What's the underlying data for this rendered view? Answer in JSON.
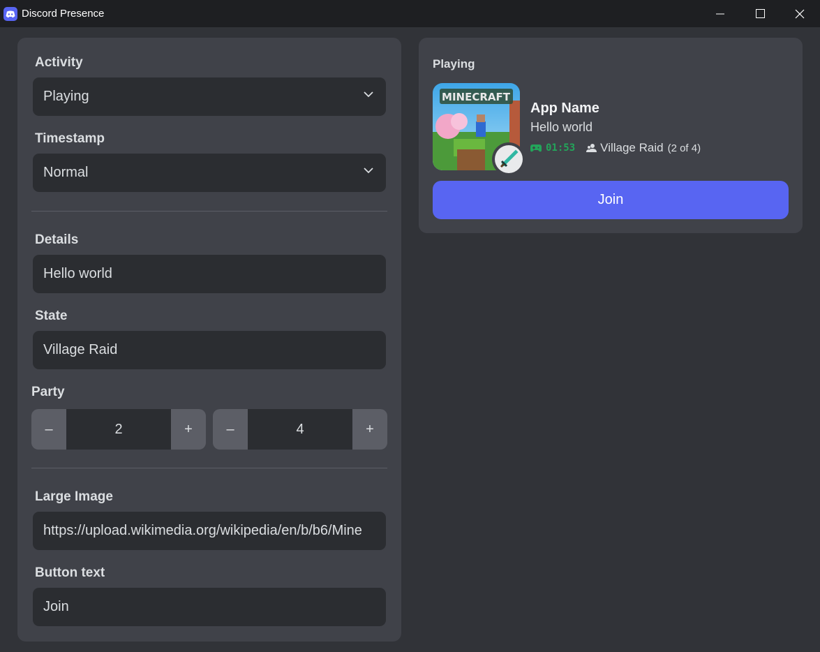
{
  "window": {
    "title": "Discord Presence"
  },
  "form": {
    "activity": {
      "label": "Activity",
      "value": "Playing"
    },
    "timestamp": {
      "label": "Timestamp",
      "value": "Normal"
    },
    "details": {
      "label": "Details",
      "value": "Hello world"
    },
    "state": {
      "label": "State",
      "value": "Village Raid"
    },
    "party": {
      "label": "Party",
      "current": "2",
      "max": "4",
      "minus": "–",
      "plus": "+"
    },
    "large_image": {
      "label": "Large Image",
      "value": "https://upload.wikimedia.org/wikipedia/en/b/b6/Mine"
    },
    "button_text": {
      "label": "Button text",
      "value": "Join"
    }
  },
  "preview": {
    "heading": "Playing",
    "app_name": "App Name",
    "details": "Hello world",
    "elapsed": "01:53",
    "state": "Village Raid",
    "party_count": "(2 of 4)",
    "button_label": "Join",
    "large_image_text": "MINECRAFT",
    "accent_color": "#5865f2",
    "timer_color": "#23a55a"
  }
}
